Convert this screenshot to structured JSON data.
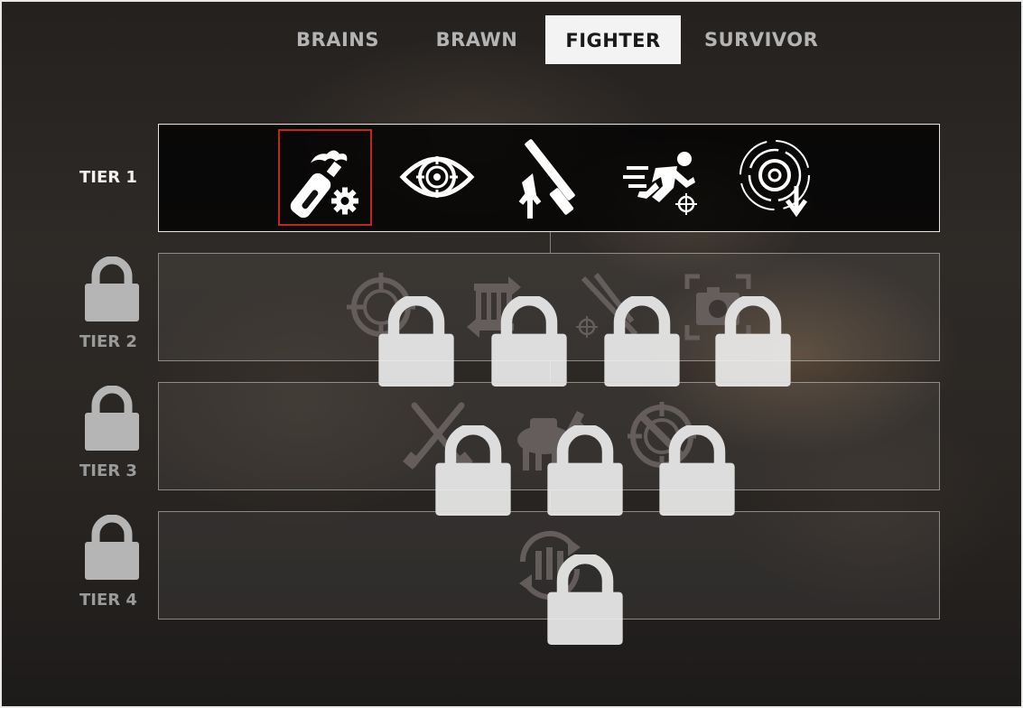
{
  "tabs": [
    {
      "label": "BRAINS",
      "active": false
    },
    {
      "label": "BRAWN",
      "active": false
    },
    {
      "label": "FIGHTER",
      "active": true
    },
    {
      "label": "SURVIVOR",
      "active": false
    }
  ],
  "tiers": [
    {
      "label": "TIER 1",
      "locked": false,
      "skills": [
        {
          "icon": "molotov-crafting-icon",
          "selected": true,
          "locked": false
        },
        {
          "icon": "eye-target-icon",
          "selected": false,
          "locked": false
        },
        {
          "icon": "rifle-upgrade-icon",
          "selected": false,
          "locked": false
        },
        {
          "icon": "sprint-aim-icon",
          "selected": false,
          "locked": false
        },
        {
          "icon": "target-recoil-down-icon",
          "selected": false,
          "locked": false
        }
      ]
    },
    {
      "label": "TIER 2",
      "locked": true,
      "skills": [
        {
          "icon": "crosshair-icon",
          "locked": true
        },
        {
          "icon": "ammo-reload-icon",
          "locked": true
        },
        {
          "icon": "arrows-target-icon",
          "locked": true
        },
        {
          "icon": "camera-focus-icon",
          "locked": true
        }
      ]
    },
    {
      "label": "TIER 3",
      "locked": true,
      "skills": [
        {
          "icon": "crossed-rifles-icon",
          "locked": true
        },
        {
          "icon": "pack-mule-icon",
          "locked": true
        },
        {
          "icon": "crossed-target-icon",
          "locked": true
        }
      ]
    },
    {
      "label": "TIER 4",
      "locked": true,
      "skills": [
        {
          "icon": "ammo-cycle-icon",
          "locked": true
        }
      ]
    }
  ],
  "colors": {
    "selected_border": "#c0281e",
    "tab_active_bg": "#f3f3f3",
    "locked_text": "#9a9a9a"
  }
}
